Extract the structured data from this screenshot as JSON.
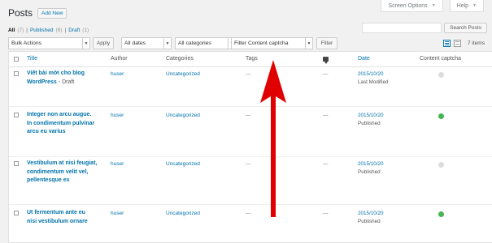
{
  "top_buttons": {
    "screen_options": "Screen Options",
    "help": "Help"
  },
  "page": {
    "title": "Posts",
    "add_new": "Add New"
  },
  "subsubsub": {
    "all_label": "All",
    "all_count": "(7)",
    "published_label": "Published",
    "published_count": "(6)",
    "draft_label": "Draft",
    "draft_count": "(1)",
    "sep": "|"
  },
  "search": {
    "placeholder": "",
    "button": "Search Posts"
  },
  "filters": {
    "bulk_actions": "Bulk Actions",
    "apply": "Apply",
    "dates": "All dates",
    "categories": "All categories",
    "captcha": "Filter Content captcha",
    "filter": "Filter"
  },
  "items_count": "7 items",
  "columns": {
    "title": "Title",
    "author": "Author",
    "categories": "Categories",
    "tags": "Tags",
    "date": "Date",
    "captcha": "Content captcha"
  },
  "colors": {
    "link": "#0073aa",
    "dot_grey": "#dddddd",
    "dot_green": "#46b450",
    "arrow": "#e00000"
  },
  "rows": [
    {
      "title_line1": "Viết bài mới cho blog",
      "title_line2": "WordPress",
      "state": " - Draft",
      "title_line3": "",
      "author": "huser",
      "category": "Uncategorized",
      "tags": "—",
      "comments": "—",
      "date": "2015/10/20",
      "status": "Last Modified",
      "captcha": "grey"
    },
    {
      "title_line1": "Integer non arcu augue.",
      "title_line2": "In condimentum pulvinar",
      "state": "",
      "title_line3": "arcu eu varius",
      "author": "huser",
      "category": "Uncategorized",
      "tags": "—",
      "comments": "—",
      "date": "2015/10/20",
      "status": "Published",
      "captcha": "green"
    },
    {
      "title_line1": "Vestibulum at nisi feugiat,",
      "title_line2": "condimentum velit vel,",
      "state": "",
      "title_line3": "pellentesque ex",
      "author": "huser",
      "category": "Uncategorized",
      "tags": "—",
      "comments": "—",
      "date": "2015/10/20",
      "status": "Published",
      "captcha": "grey"
    },
    {
      "title_line1": "Ut fermentum ante eu",
      "title_line2": "nisi vestibulum ornare",
      "state": "",
      "title_line3": "",
      "author": "huser",
      "category": "Uncategorized",
      "tags": "—",
      "comments": "—",
      "date": "2015/10/20",
      "status": "Published",
      "captcha": "green"
    }
  ]
}
